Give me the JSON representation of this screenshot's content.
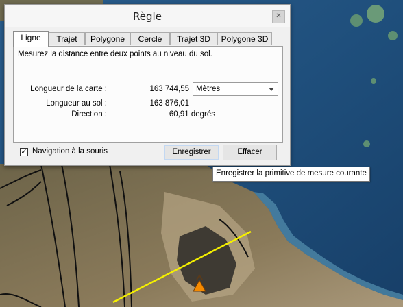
{
  "dialog": {
    "title": "Règle",
    "close_icon": "close-icon",
    "tabs": [
      {
        "label": "Ligne",
        "active": true
      },
      {
        "label": "Trajet",
        "active": false
      },
      {
        "label": "Polygone",
        "active": false
      },
      {
        "label": "Cercle",
        "active": false
      },
      {
        "label": "Trajet 3D",
        "active": false
      },
      {
        "label": "Polygone 3D",
        "active": false
      }
    ],
    "description": "Mesurez la distance entre deux points au niveau du sol.",
    "map_length": {
      "label": "Longueur de la carte :",
      "value": "163 744,55",
      "unit": "Mètres"
    },
    "ground_length": {
      "label": "Longueur au sol :",
      "value": "163 876,01"
    },
    "direction": {
      "label": "Direction :",
      "value": "60,91 degrés"
    },
    "mouse_navigation": {
      "label": "Navigation à la souris",
      "checked": true
    },
    "save_label": "Enregistrer",
    "clear_label": "Effacer"
  },
  "tooltip": "Enregistrer la primitive de mesure courante",
  "map": {
    "measure_line_color": "#f5f000",
    "volcano_icon": "volcano-icon"
  }
}
